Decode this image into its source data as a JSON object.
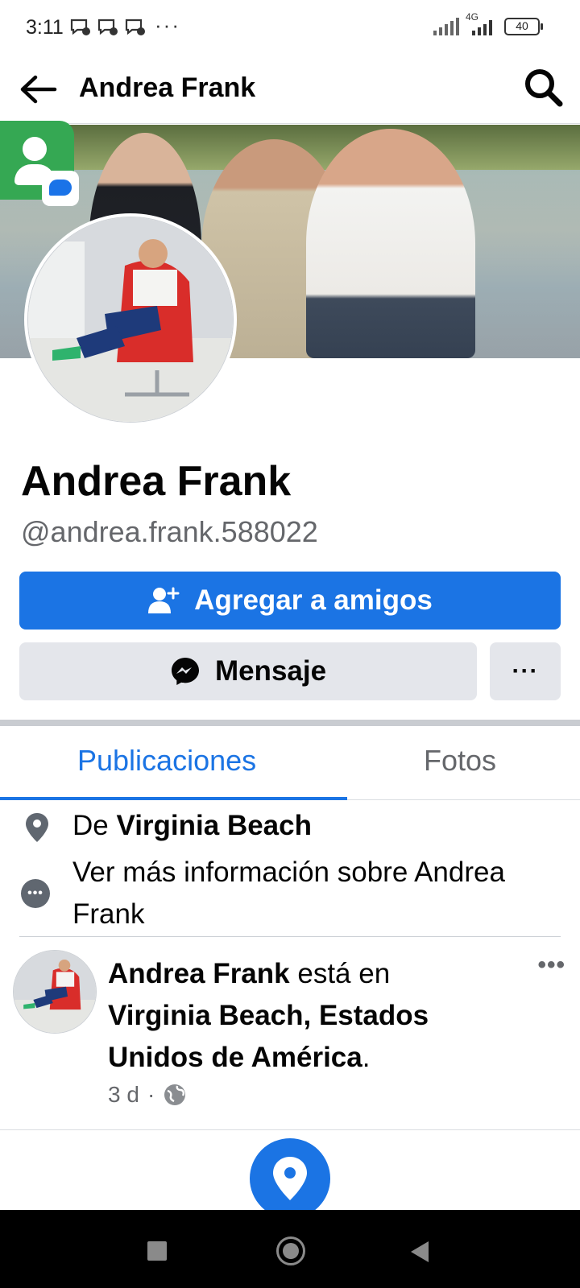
{
  "status_bar": {
    "time": "3:11",
    "more": "···",
    "network": "4G",
    "battery": "40"
  },
  "header": {
    "title": "Andrea Frank",
    "back_icon": "arrow-left-icon",
    "search_icon": "search-icon"
  },
  "profile": {
    "name": "Andrea Frank",
    "handle": "@andrea.frank.588022"
  },
  "actions": {
    "add_friend": "Agregar a amigos",
    "message": "Mensaje",
    "more": "···"
  },
  "tabs": [
    {
      "label": "Publicaciones",
      "active": true
    },
    {
      "label": "Fotos",
      "active": false
    }
  ],
  "intro": {
    "from_prefix": "De",
    "from_place": "Virginia Beach",
    "more_info": "Ver más información sobre Andrea Frank"
  },
  "post": {
    "author": "Andrea Frank",
    "verb": "está en",
    "place": "Virginia Beach, Estados Unidos de América",
    "end": ".",
    "time": "3 d",
    "separator": "·",
    "more": "•••"
  },
  "colors": {
    "accent": "#1b74e4",
    "secondary_button": "#e4e6eb",
    "muted_text": "#65676b"
  }
}
